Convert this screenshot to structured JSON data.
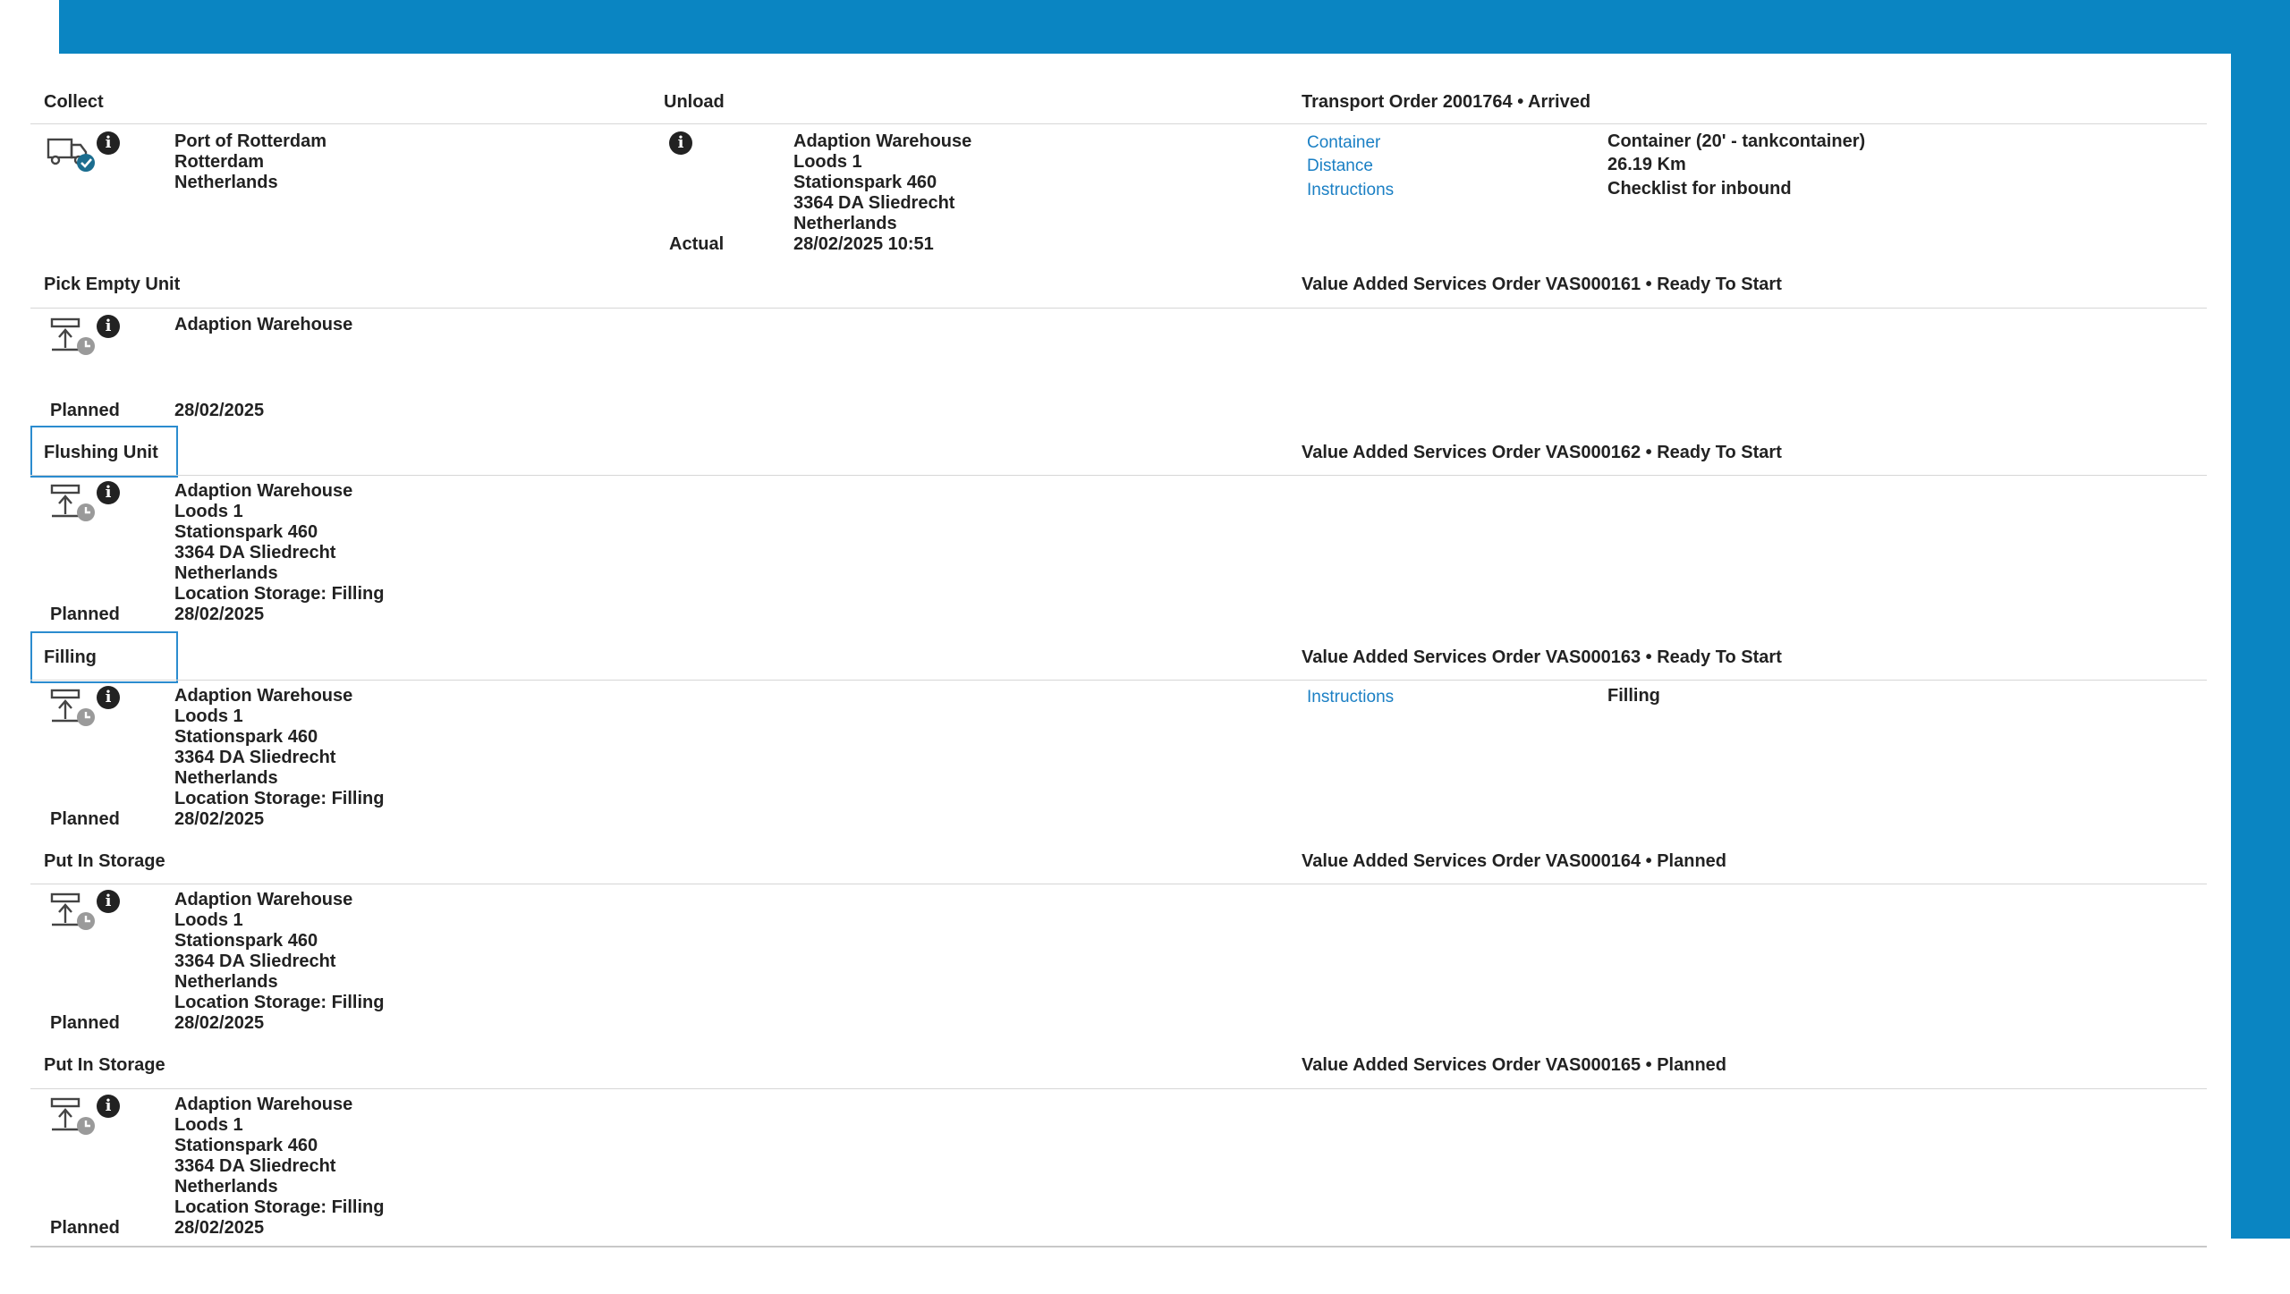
{
  "collect": {
    "title": "Collect",
    "address": [
      "Port of Rotterdam",
      "Rotterdam",
      "Netherlands"
    ]
  },
  "unload": {
    "title": "Unload",
    "address": [
      "Adaption Warehouse",
      "Loods 1",
      "Stationspark 460",
      "3364 DA Sliedrecht",
      "Netherlands"
    ],
    "actual_label": "Actual",
    "actual_value": "28/02/2025 10:51"
  },
  "transport_order": {
    "title": "Transport Order 2001764 • Arrived",
    "fields": [
      {
        "label": "Container",
        "value": "Container (20' - tankcontainer)"
      },
      {
        "label": "Distance",
        "value": "26.19 Km"
      },
      {
        "label": "Instructions",
        "value": "Checklist for inbound"
      }
    ]
  },
  "tasks": [
    {
      "title": "Pick Empty Unit",
      "address": [
        "Adaption Warehouse"
      ],
      "planned_label": "Planned",
      "planned_value": "28/02/2025",
      "order": "Value Added Services Order VAS000161 • Ready To Start"
    },
    {
      "title": "Flushing Unit",
      "address": [
        "Adaption Warehouse",
        "Loods 1",
        "Stationspark 460",
        "3364 DA Sliedrecht",
        "Netherlands",
        "Location Storage: Filling"
      ],
      "planned_label": "Planned",
      "planned_value": "28/02/2025",
      "order": "Value Added Services Order VAS000162 • Ready To Start"
    },
    {
      "title": "Filling",
      "address": [
        "Adaption Warehouse",
        "Loods 1",
        "Stationspark 460",
        "3364 DA Sliedrecht",
        "Netherlands",
        "Location Storage: Filling"
      ],
      "planned_label": "Planned",
      "planned_value": "28/02/2025",
      "order": "Value Added Services Order VAS000163 • Ready To Start",
      "instructions_label": "Instructions",
      "instructions_value": "Filling"
    },
    {
      "title": "Put In Storage",
      "address": [
        "Adaption Warehouse",
        "Loods 1",
        "Stationspark 460",
        "3364 DA Sliedrecht",
        "Netherlands",
        "Location Storage: Filling"
      ],
      "planned_label": "Planned",
      "planned_value": "28/02/2025",
      "order": "Value Added Services Order VAS000164 • Planned"
    },
    {
      "title": "Put In Storage",
      "address": [
        "Adaption Warehouse",
        "Loods 1",
        "Stationspark 460",
        "3364 DA Sliedrecht",
        "Netherlands",
        "Location Storage: Filling"
      ],
      "planned_label": "Planned",
      "planned_value": "28/02/2025",
      "order": "Value Added Services Order VAS000165 • Planned"
    }
  ],
  "icons": {
    "info": "info-icon",
    "collect_status": "truck-check-icon",
    "task_status": "unload-clock-icon"
  },
  "colors": {
    "brand_blue": "#0a85c2",
    "link": "#1a7fc4",
    "highlight": "#2b8ccf",
    "text": "#222222"
  }
}
